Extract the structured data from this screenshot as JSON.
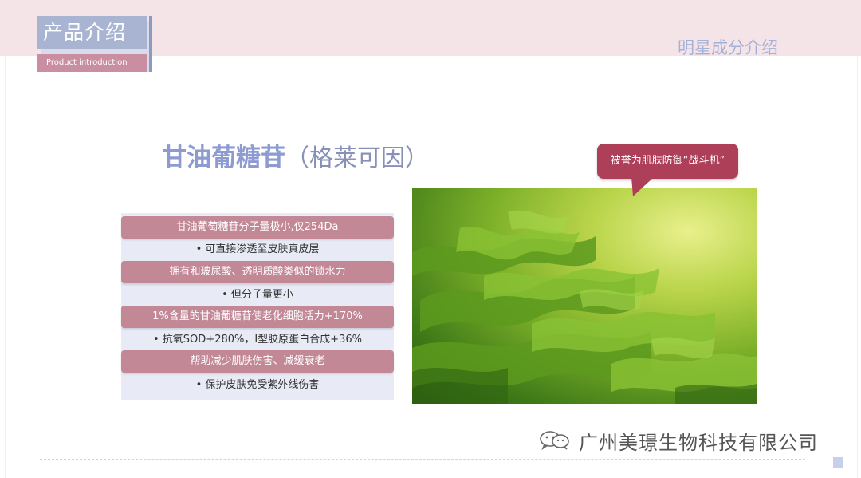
{
  "header": {
    "badge_title": "产品介绍",
    "badge_subtitle": "Product introduction",
    "section_title": "明星成分介绍"
  },
  "headline": {
    "main": "甘油葡糖苷",
    "paren": "（格莱可因）"
  },
  "callout": "被誉为肌肤防御“战斗机”",
  "list": [
    {
      "text": "甘油葡萄糖苷分子量极小,仅254Da",
      "style": "pill"
    },
    {
      "text": "• 可直接渗透至皮肤真皮层",
      "style": "plain"
    },
    {
      "text": "拥有和玻尿酸、透明质酸类似的锁水力",
      "style": "pill"
    },
    {
      "text": "• 但分子量更小",
      "style": "plain"
    },
    {
      "text": "1%含量的甘油葡糖苷使老化细胞活力+170%",
      "style": "pill"
    },
    {
      "text": "• 抗氧SOD+280%，Ⅰ型胶原蛋白合成+36%",
      "style": "plain"
    },
    {
      "text": "帮助减少肌肤伤害、减缓衰老",
      "style": "pill"
    },
    {
      "text": "• 保护皮肤免受紫外线伤害",
      "style": "plain"
    }
  ],
  "photo": {
    "subject": "green cypress foliage",
    "icon": "plant-photo"
  },
  "footer": {
    "company": "广州美璟生物科技有限公司",
    "icon": "wechat-icon"
  },
  "colors": {
    "band": "#f4e3e7",
    "pill": "#c28896",
    "callout": "#ad3f59",
    "headline": "#8d9bd1"
  }
}
